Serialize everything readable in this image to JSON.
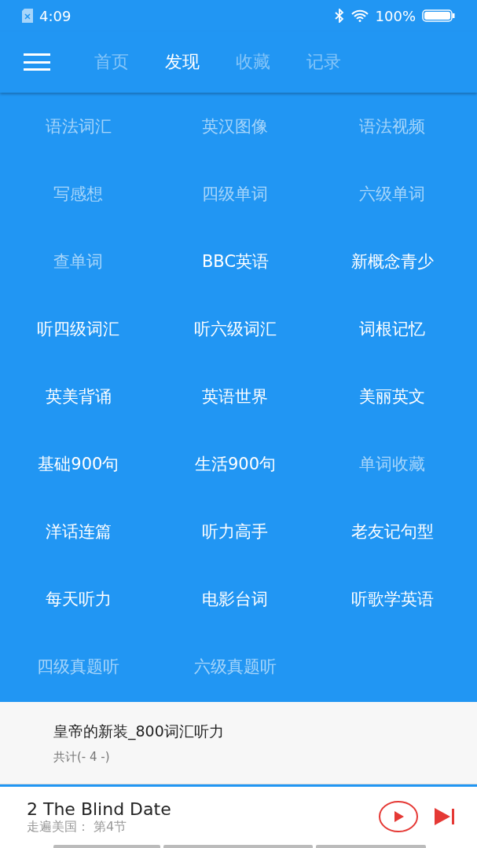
{
  "status_bar": {
    "time": "4:09",
    "battery": "100%"
  },
  "tabs": [
    {
      "label": "首页",
      "selected": false
    },
    {
      "label": "发现",
      "selected": true
    },
    {
      "label": "收藏",
      "selected": false
    },
    {
      "label": "记录",
      "selected": false
    }
  ],
  "grid": [
    {
      "label": "语法词汇",
      "dimmed": true
    },
    {
      "label": "英汉图像",
      "dimmed": true
    },
    {
      "label": "语法视频",
      "dimmed": true
    },
    {
      "label": "写感想",
      "dimmed": true
    },
    {
      "label": "四级单词",
      "dimmed": true
    },
    {
      "label": "六级单词",
      "dimmed": true
    },
    {
      "label": "查单词",
      "dimmed": true
    },
    {
      "label": "BBC英语",
      "dimmed": false
    },
    {
      "label": "新概念青少",
      "dimmed": false
    },
    {
      "label": "听四级词汇",
      "dimmed": false
    },
    {
      "label": "听六级词汇",
      "dimmed": false
    },
    {
      "label": "词根记忆",
      "dimmed": false
    },
    {
      "label": "英美背诵",
      "dimmed": false
    },
    {
      "label": "英语世界",
      "dimmed": false
    },
    {
      "label": "美丽英文",
      "dimmed": false
    },
    {
      "label": "基础900句",
      "dimmed": false
    },
    {
      "label": "生活900句",
      "dimmed": false
    },
    {
      "label": "单词收藏",
      "dimmed": true
    },
    {
      "label": "洋话连篇",
      "dimmed": false
    },
    {
      "label": "听力高手",
      "dimmed": false
    },
    {
      "label": "老友记句型",
      "dimmed": false
    },
    {
      "label": "每天听力",
      "dimmed": false
    },
    {
      "label": "电影台词",
      "dimmed": false
    },
    {
      "label": "听歌学英语",
      "dimmed": false
    },
    {
      "label": "四级真题听",
      "dimmed": true
    },
    {
      "label": "六级真题听",
      "dimmed": true
    }
  ],
  "book": {
    "title": "皇帝的新装_800词汇听力",
    "count": "共计(- 4 -)"
  },
  "player": {
    "title": "2 The Blind Date",
    "subtitle": "走遍美国： 第4节"
  }
}
